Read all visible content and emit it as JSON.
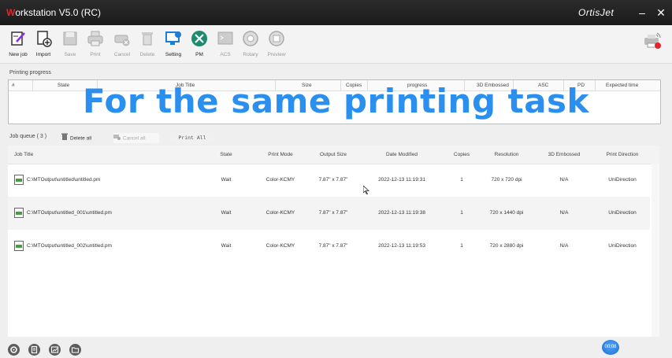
{
  "titlebar": {
    "title_mark": "W",
    "title_rest": "orkstation V5.0 (RC)",
    "brand": "OrtisJet"
  },
  "toolbar": [
    {
      "id": "new-job",
      "label": "New job",
      "enabled": true
    },
    {
      "id": "import",
      "label": "Import",
      "enabled": true
    },
    {
      "id": "save",
      "label": "Save",
      "enabled": false
    },
    {
      "id": "print",
      "label": "Print",
      "enabled": false
    },
    {
      "id": "cancel",
      "label": "Cancel",
      "enabled": false
    },
    {
      "id": "delete",
      "label": "Delete",
      "enabled": false
    },
    {
      "id": "setting",
      "label": "Setting",
      "enabled": true
    },
    {
      "id": "pm",
      "label": "PM",
      "enabled": true
    },
    {
      "id": "acs",
      "label": "ACS",
      "enabled": false
    },
    {
      "id": "rotary",
      "label": "Rotary",
      "enabled": false
    },
    {
      "id": "preview",
      "label": "Preview",
      "enabled": false
    }
  ],
  "progress": {
    "label": "Printing progress",
    "columns": [
      "#",
      "State",
      "Job Title",
      "Size",
      "Copies",
      "progress",
      "3D Embossed",
      "ASC",
      "PD",
      "Expected time"
    ]
  },
  "overlay_text": "For the same printing task",
  "queue": {
    "label": "Job queue ( 3 )",
    "delete_all": "Delete all",
    "cancel_all": "Cancel all",
    "print_all": "Print All",
    "columns": [
      "Job Title",
      "State",
      "Print Mode",
      "Output Size",
      "Date Modified",
      "Copies",
      "Resolution",
      "3D Embossed",
      "Print Direction"
    ],
    "rows": [
      {
        "title": "C:\\MTOutput\\untitled\\untitled.pm",
        "state": "Wait",
        "mode": "Color-KCMY",
        "size": "7.87\" x 7.87\"",
        "date": "2022-12-13 11:19:31",
        "copies": "1",
        "resolution": "720 x 720 dpi",
        "embossed": "N/A",
        "direction": "UniDirection"
      },
      {
        "title": "C:\\MTOutput\\untitled_001\\untitled.pm",
        "state": "Wait",
        "mode": "Color-KCMY",
        "size": "7.87\" x 7.87\"",
        "date": "2022-12-13 11:19:38",
        "copies": "1",
        "resolution": "720 x 1440 dpi",
        "embossed": "N/A",
        "direction": "UniDirection"
      },
      {
        "title": "C:\\MTOutput\\untitled_002\\untitled.pm",
        "state": "Wait",
        "mode": "Color-KCMY",
        "size": "7.87\" x 7.87\"",
        "date": "2022-12-13 11:19:53",
        "copies": "1",
        "resolution": "720 x 2880 dpi",
        "embossed": "N/A",
        "direction": "UniDirection"
      }
    ]
  },
  "timer": "00:08",
  "colors": {
    "accent": "#2b8ff0",
    "pm_green": "#1e8a6e",
    "setting_blue": "#1a7fd4",
    "brand_red": "#e0262b"
  }
}
